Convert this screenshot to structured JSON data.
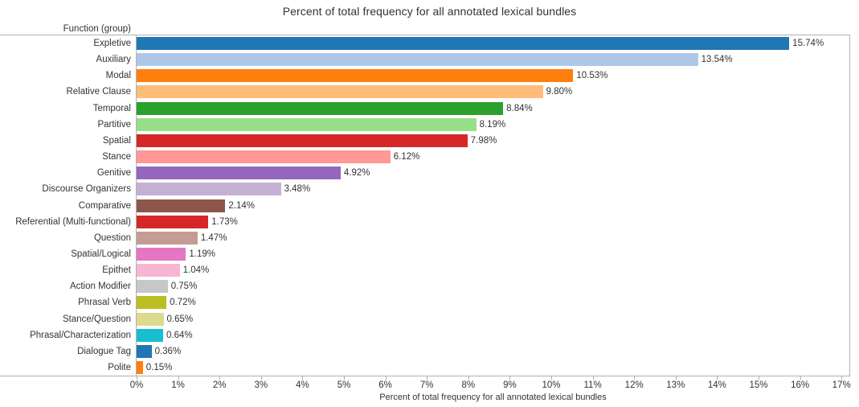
{
  "chart_data": {
    "type": "bar",
    "orientation": "horizontal",
    "title": "Percent of total frequency for all annotated lexical bundles",
    "xlabel": "Percent of total frequency for all annotated lexical bundles",
    "ylabel": "Function (group)",
    "xlim": [
      0,
      17
    ],
    "grid": false,
    "legend": "none",
    "x_tick_labels": [
      "0%",
      "1%",
      "2%",
      "3%",
      "4%",
      "5%",
      "6%",
      "7%",
      "8%",
      "9%",
      "10%",
      "11%",
      "12%",
      "13%",
      "14%",
      "15%",
      "16%",
      "17%"
    ],
    "x_tick_values": [
      0,
      1,
      2,
      3,
      4,
      5,
      6,
      7,
      8,
      9,
      10,
      11,
      12,
      13,
      14,
      15,
      16,
      17
    ],
    "categories": [
      "Expletive",
      "Auxiliary",
      "Modal",
      "Relative Clause",
      "Temporal",
      "Partitive",
      "Spatial",
      "Stance",
      "Genitive",
      "Discourse Organizers",
      "Comparative",
      "Referential (Multi-functional)",
      "Question",
      "Spatial/Logical",
      "Epithet",
      "Action Modifier",
      "Phrasal Verb",
      "Stance/Question",
      "Phrasal/Characterization",
      "Dialogue Tag",
      "Polite"
    ],
    "values": [
      15.74,
      13.54,
      10.53,
      9.8,
      8.84,
      8.19,
      7.98,
      6.12,
      4.92,
      3.48,
      2.14,
      1.73,
      1.47,
      1.19,
      1.04,
      0.75,
      0.72,
      0.65,
      0.64,
      0.36,
      0.15
    ],
    "value_labels": [
      "15.74%",
      "13.54%",
      "10.53%",
      "9.80%",
      "8.84%",
      "8.19%",
      "7.98%",
      "6.12%",
      "4.92%",
      "3.48%",
      "2.14%",
      "1.73%",
      "1.47%",
      "1.19%",
      "1.04%",
      "0.75%",
      "0.72%",
      "0.65%",
      "0.64%",
      "0.36%",
      "0.15%"
    ],
    "colors": [
      "#1f77b4",
      "#aec7e8",
      "#ff7f0e",
      "#ffbb78",
      "#2ca02c",
      "#98df8a",
      "#d62728",
      "#ff9896",
      "#9467bd",
      "#c5b0d5",
      "#8c564b",
      "#d62728",
      "#c49c94",
      "#e377c2",
      "#f7b6d2",
      "#c7c7c7",
      "#bcbd22",
      "#dbdb8d",
      "#17becf",
      "#1f77b4",
      "#ff7f0e"
    ]
  },
  "axis_header": "Function (group)"
}
